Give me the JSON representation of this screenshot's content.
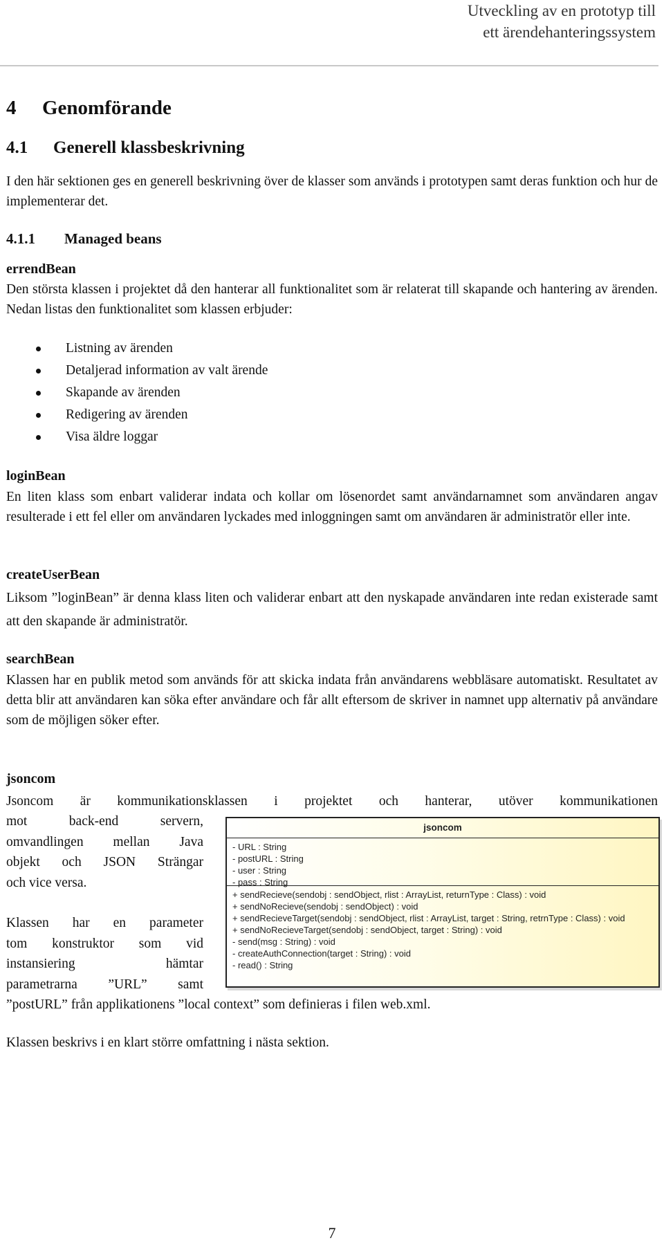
{
  "header": {
    "line1": "Utveckling av en prototyp till",
    "line2": "ett ärendehanteringssystem"
  },
  "chapter": {
    "number": "4",
    "title": "Genomförande"
  },
  "section": {
    "number": "4.1",
    "title": "Generell klassbeskrivning"
  },
  "section_intro": "I den här sektionen ges en generell beskrivning över de klasser som används i prototypen samt deras funktion och hur de implementerar det.",
  "subsection": {
    "number": "4.1.1",
    "title": "Managed beans"
  },
  "errendBean": {
    "name": "errendBean",
    "text": "Den största klassen i projektet då den hanterar all funktionalitet som är relaterat till skapande och hantering av ärenden. Nedan listas den funktionalitet som klassen erbjuder:",
    "features": [
      "Listning av ärenden",
      "Detaljerad information av valt ärende",
      "Skapande av ärenden",
      "Redigering av ärenden",
      "Visa äldre loggar"
    ]
  },
  "loginBean": {
    "name": "loginBean",
    "text": "En liten klass som enbart validerar indata och kollar om lösenordet samt användarnamnet som användaren angav resulterade i ett fel eller om användaren lyckades med inloggningen samt om användaren är administratör eller inte."
  },
  "createUserBean": {
    "name": "createUserBean",
    "text": "Liksom ”loginBean” är denna klass liten och validerar enbart att den nyskapade användaren inte redan existerade samt att den skapande är administratör."
  },
  "searchBean": {
    "name": "searchBean",
    "text": "Klassen har en publik metod som används för att skicka indata från användarens webbläsare automatiskt. Resultatet av detta blir att användaren kan söka efter användare och får allt eftersom de skriver in namnet upp alternativ på användare som de möjligen söker efter."
  },
  "jsoncom": {
    "name": "jsoncom",
    "text_full_line": "Jsoncom är kommunikationsklassen i projektet och hanterar, utöver kommunikationen",
    "wrap_lines_1": [
      "mot back-end servern,",
      "omvandlingen mellan Java",
      "objekt och JSON Strängar",
      "och vice versa."
    ],
    "wrap_lines_2": [
      "Klassen har en parameter",
      "tom konstruktor som vid",
      "instansiering hämtar",
      "parametrarna ”URL” samt"
    ],
    "continuation": "”postURL” från applikationens ”local context” som definieras i filen web.xml.",
    "closing": "Klassen beskrivs i en klart större omfattning i nästa sektion."
  },
  "uml": {
    "class_name": "jsoncom",
    "attributes": [
      "- URL : String",
      "- postURL : String",
      "- user : String",
      "- pass : String"
    ],
    "methods": [
      "+ sendRecieve(sendobj : sendObject, rlist : ArrayList, returnType : Class) : void",
      "+ sendNoRecieve(sendobj : sendObject) : void",
      "+ sendRecieveTarget(sendobj : sendObject, rlist : ArrayList, target : String, retrnType : Class) : void",
      "+ sendNoRecieveTarget(sendobj : sendObject, target : String) : void",
      "- send(msg : String) : void",
      "- createAuthConnection(target : String) : void",
      "- read() : String"
    ]
  },
  "page_number": "7"
}
